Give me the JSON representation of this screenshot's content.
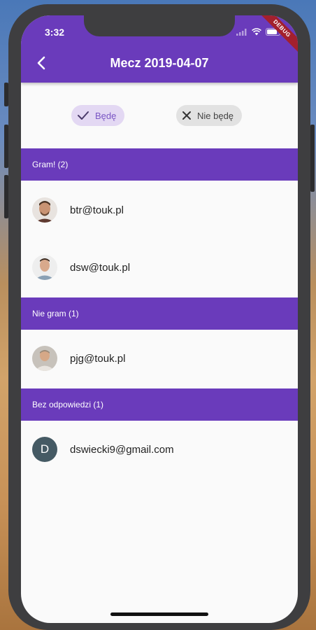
{
  "status_bar": {
    "time": "3:32",
    "debug_label": "DEBUG"
  },
  "app_bar": {
    "title": "Mecz 2019-04-07",
    "back_icon": "arrow-back-icon"
  },
  "choices": {
    "yes_label": "Będę",
    "no_label": "Nie będę",
    "selected": "yes"
  },
  "sections": [
    {
      "header": "Gram! (2)",
      "users": [
        {
          "email": "btr@touk.pl",
          "avatar": "photo"
        },
        {
          "email": "dsw@touk.pl",
          "avatar": "photo"
        }
      ]
    },
    {
      "header": "Nie gram (1)",
      "users": [
        {
          "email": "pjg@touk.pl",
          "avatar": "photo"
        }
      ]
    },
    {
      "header": "Bez odpowiedzi (1)",
      "users": [
        {
          "email": "dswiecki9@gmail.com",
          "avatar": "D"
        }
      ]
    }
  ],
  "colors": {
    "primary": "#6a3bbb",
    "chip_selected_bg": "#e3d8f3",
    "chip_selected_fg": "#7a55c4",
    "chip_bg": "#e2e2e2",
    "letter_avatar_bg": "#455a64",
    "debug_banner": "#a3202d"
  }
}
